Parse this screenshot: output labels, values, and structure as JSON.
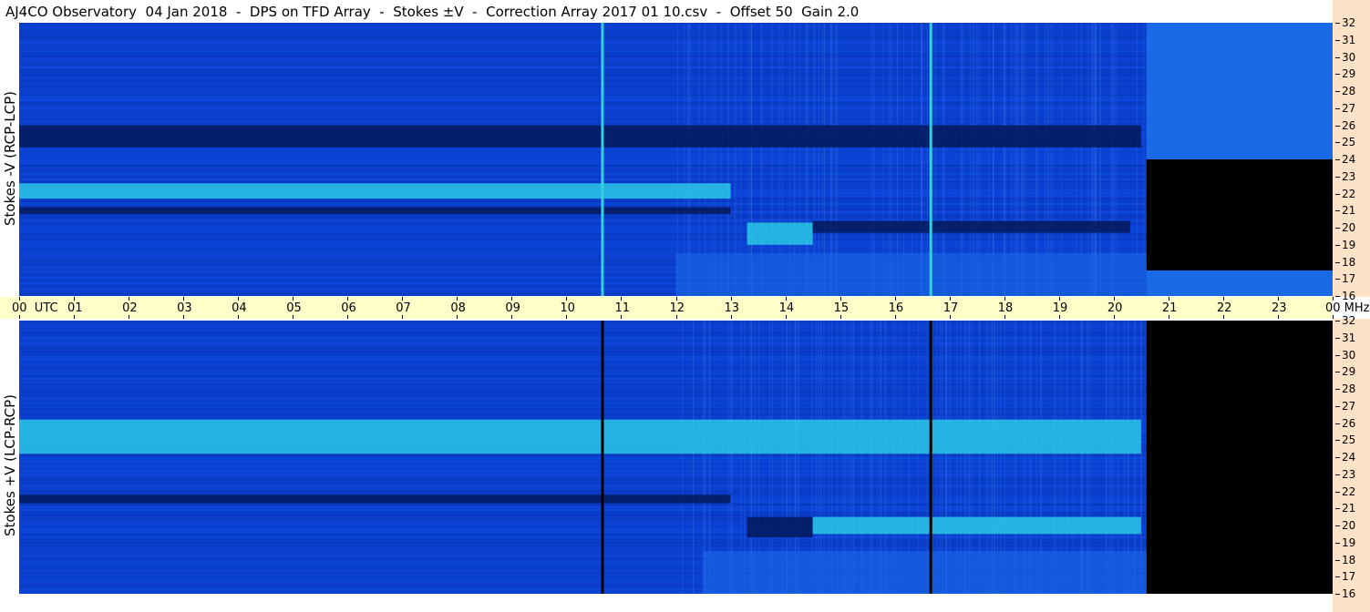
{
  "header": {
    "title": "AJ4CO Observatory  04 Jan 2018  -  DPS on TFD Array  -  Stokes ±V  -  Correction Array 2017 01 10.csv  -  Offset 50  Gain 2.0"
  },
  "panels": {
    "top_ylabel": "Stokes -V (RCP-LCP)",
    "bottom_ylabel": "Stokes +V (LCP-RCP)"
  },
  "chart_data": {
    "type": "heatmap",
    "title": "AJ4CO Observatory  04 Jan 2018  -  DPS on TFD Array  -  Stokes ±V  -  Correction Array 2017 01 10.csv  -  Offset 50  Gain 2.0",
    "xlabel": "UTC",
    "ylabel_unit": "MHz",
    "x_tick_labels": [
      "00",
      "01",
      "02",
      "03",
      "04",
      "05",
      "06",
      "07",
      "08",
      "09",
      "10",
      "11",
      "12",
      "13",
      "14",
      "15",
      "16",
      "17",
      "18",
      "19",
      "20",
      "21",
      "22",
      "23",
      "00"
    ],
    "y_tick_labels": [
      "32",
      "31",
      "30",
      "29",
      "28",
      "27",
      "26",
      "25",
      "24",
      "23",
      "22",
      "21",
      "20",
      "19",
      "18",
      "17",
      "16"
    ],
    "xlim": [
      0,
      24
    ],
    "ylim": [
      16,
      32
    ],
    "colors": {
      "background": "#0b3fd0",
      "dark": "#041a5a",
      "bright": "#2cc8e6",
      "hot": "#8af08a",
      "strip": "#fde2c8",
      "timebar": "#fffec8"
    },
    "data_end_utc": 20.6,
    "panels": [
      {
        "name": "Stokes -V (RCP-LCP)",
        "vertical_lines_utc": [
          10.65,
          16.65
        ],
        "vertical_line_color": "#35d0e0",
        "bands": [
          {
            "mhz_from": 24.7,
            "mhz_to": 26.0,
            "t_from": 0,
            "t_to": 20.5,
            "level": "dark"
          },
          {
            "mhz_from": 21.7,
            "mhz_to": 22.6,
            "t_from": 0,
            "t_to": 13.0,
            "level": "bright"
          },
          {
            "mhz_from": 20.8,
            "mhz_to": 21.2,
            "t_from": 0,
            "t_to": 13.0,
            "level": "dark"
          },
          {
            "mhz_from": 19.0,
            "mhz_to": 20.3,
            "t_from": 13.3,
            "t_to": 14.5,
            "level": "bright"
          },
          {
            "mhz_from": 19.7,
            "mhz_to": 20.4,
            "t_from": 14.5,
            "t_to": 20.3,
            "level": "dark"
          },
          {
            "mhz_from": 16.0,
            "mhz_to": 18.5,
            "t_from": 12.0,
            "t_to": 20.6,
            "level": "mid"
          }
        ],
        "after_end": [
          {
            "mhz_from": 16.0,
            "mhz_to": 17.5,
            "level": "mid"
          },
          {
            "mhz_from": 17.5,
            "mhz_to": 24.0,
            "level": "black"
          },
          {
            "mhz_from": 24.0,
            "mhz_to": 32.0,
            "level": "mid"
          }
        ]
      },
      {
        "name": "Stokes +V (LCP-RCP)",
        "vertical_lines_utc": [
          10.65,
          16.65
        ],
        "vertical_line_color": "#000000",
        "bands": [
          {
            "mhz_from": 24.2,
            "mhz_to": 26.2,
            "t_from": 0,
            "t_to": 20.5,
            "level": "bright"
          },
          {
            "mhz_from": 21.3,
            "mhz_to": 21.8,
            "t_from": 0,
            "t_to": 13.0,
            "level": "dark"
          },
          {
            "mhz_from": 19.3,
            "mhz_to": 20.5,
            "t_from": 13.3,
            "t_to": 14.5,
            "level": "dark"
          },
          {
            "mhz_from": 19.5,
            "mhz_to": 20.5,
            "t_from": 14.5,
            "t_to": 20.5,
            "level": "bright"
          },
          {
            "mhz_from": 16.0,
            "mhz_to": 18.5,
            "t_from": 12.5,
            "t_to": 20.6,
            "level": "mid"
          }
        ],
        "after_end": [
          {
            "mhz_from": 16.0,
            "mhz_to": 32.0,
            "level": "black"
          }
        ]
      }
    ]
  }
}
